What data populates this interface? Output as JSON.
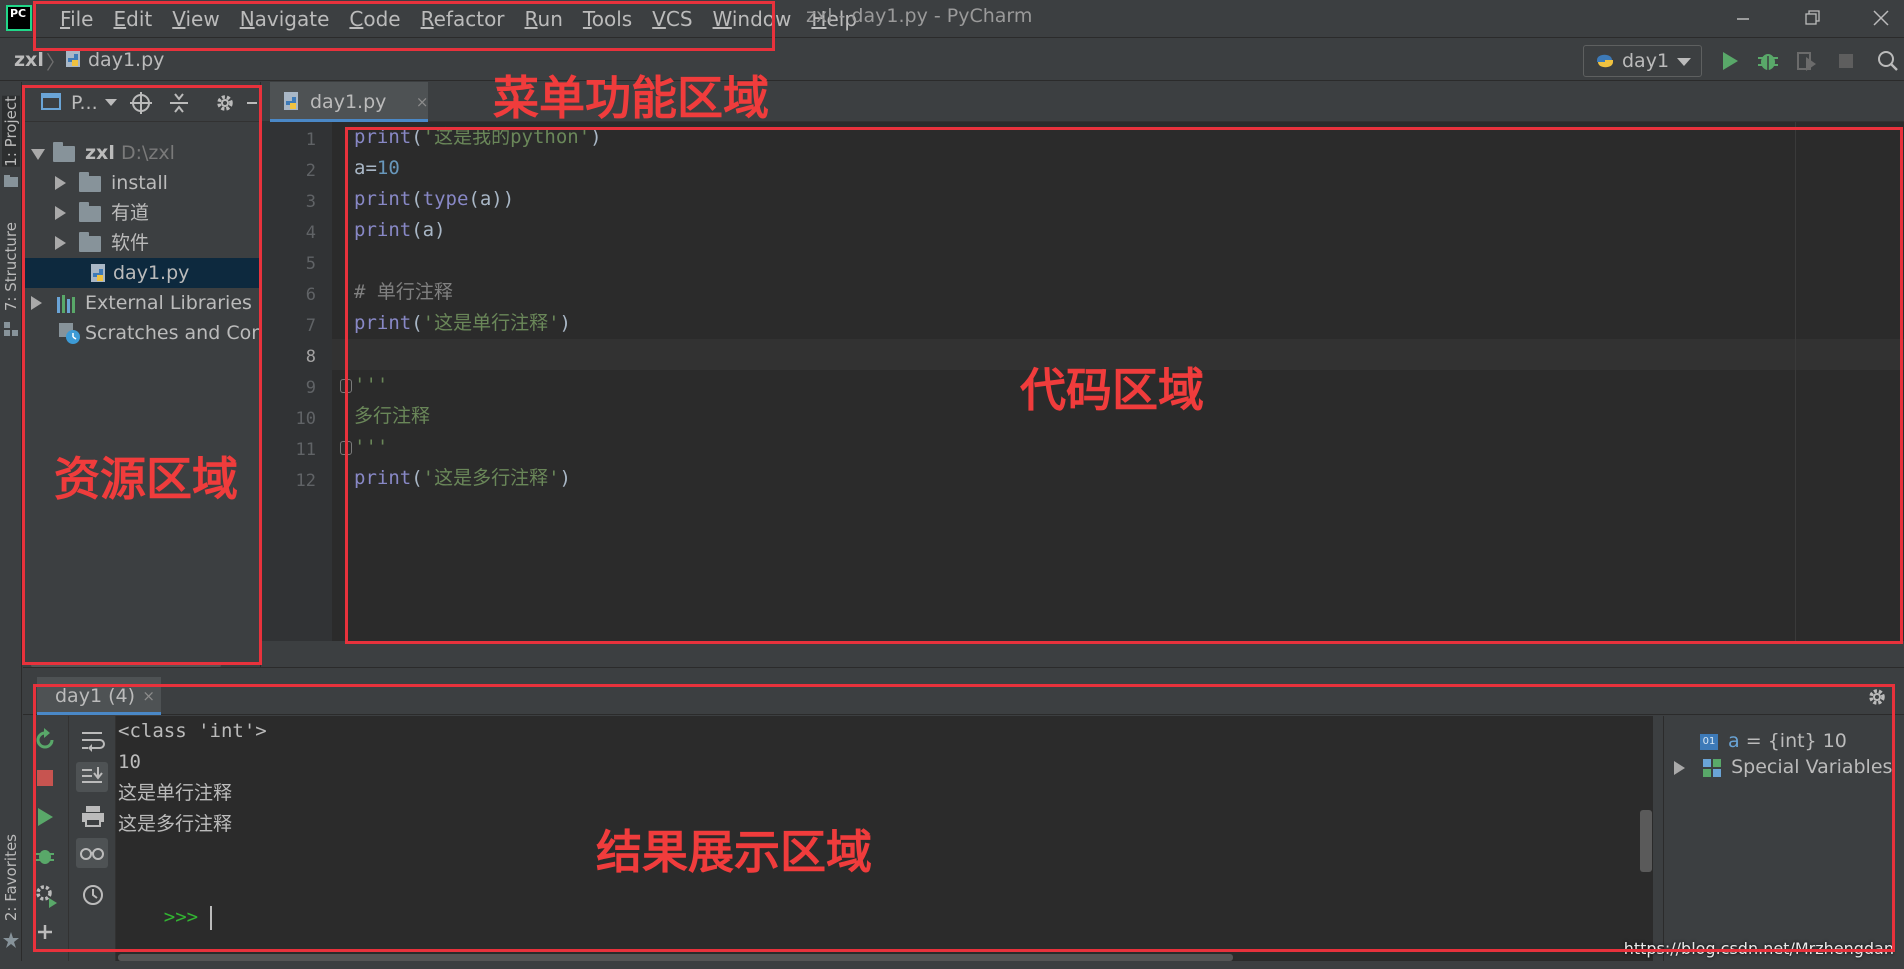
{
  "app": {
    "logo": "PC",
    "window_title": "zxl - day1.py - PyCharm"
  },
  "menu": [
    "File",
    "Edit",
    "View",
    "Navigate",
    "Code",
    "Refactor",
    "Run",
    "Tools",
    "VCS",
    "Window",
    "Help"
  ],
  "navbar": {
    "project": "zxl",
    "separator": "〉",
    "file": "day1.py",
    "run_config": "day1"
  },
  "stripes": {
    "project": "1: Project",
    "structure": "7: Structure",
    "favorites": "2: Favorites"
  },
  "project_panel": {
    "title": "P...",
    "tree": [
      {
        "label": "zxl",
        "hint": "D:\\zxl",
        "level": 0,
        "expanded": true,
        "kind": "folder"
      },
      {
        "label": "install",
        "level": 1,
        "expanded": false,
        "kind": "folder"
      },
      {
        "label": "有道",
        "level": 1,
        "expanded": false,
        "kind": "folder"
      },
      {
        "label": "软件",
        "level": 1,
        "expanded": false,
        "kind": "folder"
      },
      {
        "label": "day1.py",
        "level": 2,
        "kind": "python-file",
        "selected": true
      },
      {
        "label": "External Libraries",
        "level": 0,
        "expanded": false,
        "kind": "library"
      },
      {
        "label": "Scratches and Consoles",
        "level": 0,
        "kind": "scratch"
      }
    ]
  },
  "editor": {
    "tab_label": "day1.py",
    "tab_close": "×",
    "caret_line": 8,
    "line_numbers": [
      "1",
      "2",
      "3",
      "4",
      "5",
      "6",
      "7",
      "8",
      "9",
      "10",
      "11",
      "12"
    ],
    "lines": [
      [
        {
          "t": "kw",
          "v": "print"
        },
        {
          "t": "p",
          "v": "("
        },
        {
          "t": "str",
          "v": "'这是我的python'"
        },
        {
          "t": "p",
          "v": ")"
        }
      ],
      [
        {
          "t": "p",
          "v": "a="
        },
        {
          "t": "num",
          "v": "10"
        }
      ],
      [
        {
          "t": "kw",
          "v": "print"
        },
        {
          "t": "p",
          "v": "("
        },
        {
          "t": "kw",
          "v": "type"
        },
        {
          "t": "p",
          "v": "(a))"
        }
      ],
      [
        {
          "t": "kw",
          "v": "print"
        },
        {
          "t": "p",
          "v": "(a)"
        }
      ],
      [],
      [
        {
          "t": "cmt",
          "v": "# 单行注释"
        }
      ],
      [
        {
          "t": "kw",
          "v": "print"
        },
        {
          "t": "p",
          "v": "("
        },
        {
          "t": "str",
          "v": "'这是单行注释'"
        },
        {
          "t": "p",
          "v": ")"
        }
      ],
      [],
      [
        {
          "t": "str",
          "v": "'''"
        }
      ],
      [
        {
          "t": "str",
          "v": "多行注释"
        }
      ],
      [
        {
          "t": "str",
          "v": "'''"
        }
      ],
      [
        {
          "t": "kw",
          "v": "print"
        },
        {
          "t": "p",
          "v": "("
        },
        {
          "t": "str",
          "v": "'这是多行注释'"
        },
        {
          "t": "p",
          "v": ")"
        }
      ]
    ]
  },
  "run_panel": {
    "tab_label": "day1 (4)",
    "tab_close": "×",
    "output": [
      "<class 'int'>",
      "10",
      "这是单行注释",
      "这是多行注释"
    ],
    "prompt": ">>>",
    "variables": {
      "a_badge": "01",
      "a_name": "a",
      "a_value": " = {int} 10",
      "special": "Special Variables"
    }
  },
  "annotations": {
    "menu_area": "菜单功能区域",
    "resource_area": "资源区域",
    "code_area": "代码区域",
    "result_area": "结果展示区域",
    "color": "#e8323c"
  },
  "watermark": "https://blog.csdn.net/Mrzhengdan",
  "colors": {
    "background": "#3c3f41",
    "editor_bg": "#2b2b2b",
    "keyword": "#8888c6",
    "string": "#6a8759",
    "number": "#6897bb",
    "comment": "#808080",
    "run_green": "#59a869",
    "stop_red": "#c75450"
  }
}
